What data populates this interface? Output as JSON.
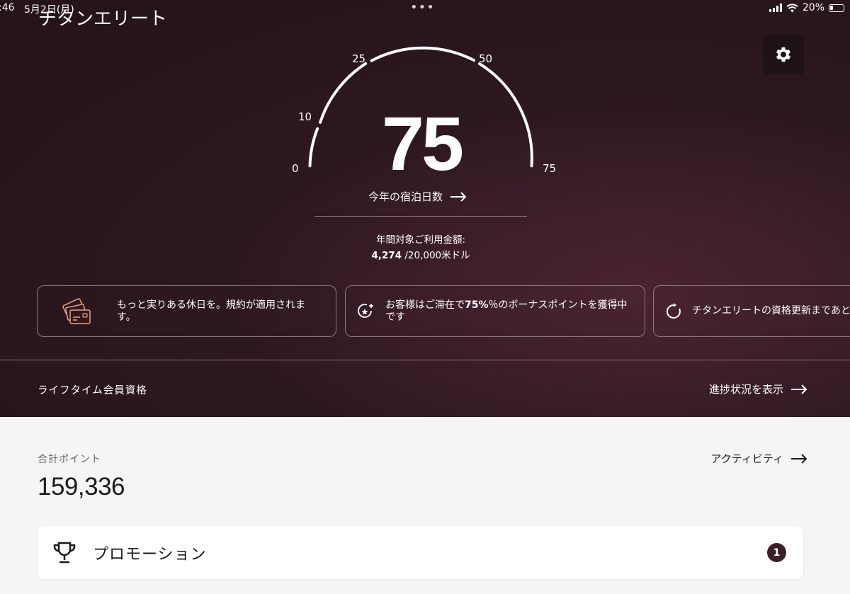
{
  "status": {
    "time": ":46",
    "date": "5月2日(月)",
    "dots": "•••",
    "battery": "20%"
  },
  "header": {
    "title": "チタンエリート"
  },
  "gauge": {
    "value": "75",
    "max": 75,
    "ticks": [
      "0",
      "10",
      "25",
      "50",
      "75"
    ],
    "nights_label": "今年の宿泊日数"
  },
  "spend": {
    "label": "年間対象ご利用金額:",
    "current": "4,274",
    "target": " /20,000米ドル"
  },
  "cards": [
    {
      "icon": "credit-cards-icon",
      "text": "もっと実りある休日を。規約が適用されます。"
    },
    {
      "icon": "star-sparkle-icon",
      "text_before": "お客様はご滞在で",
      "text_bold": "75%",
      "text_after": "％のボーナスポイントを獲得中です"
    },
    {
      "icon": "refresh-icon",
      "text": "チタンエリートの資格更新まであと"
    }
  ],
  "lifetime": {
    "label": "ライフタイム会員資格",
    "link": "進捗状況を表示"
  },
  "points": {
    "label": "合計ポイント",
    "value": "159,336",
    "activity_link": "アクティビティ"
  },
  "promotion": {
    "label": "プロモーション",
    "badge": "1"
  },
  "colors": {
    "hero_bg": "#2e1820",
    "accent": "#3a1e28",
    "card_icon": "#e7a27e"
  }
}
